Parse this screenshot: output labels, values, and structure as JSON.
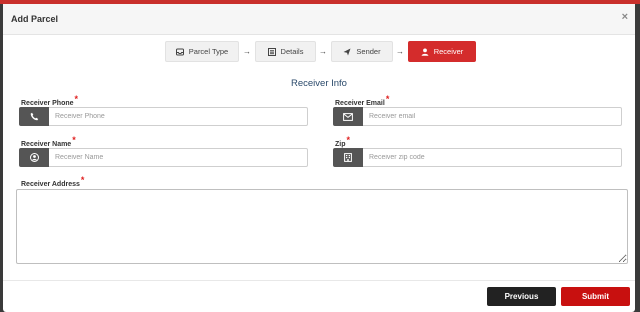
{
  "modal": {
    "title": "Add Parcel",
    "close_label": "×"
  },
  "steps": [
    {
      "label": "Parcel Type",
      "icon": "inbox-icon",
      "active": false
    },
    {
      "label": "Details",
      "icon": "list-icon",
      "active": false
    },
    {
      "label": "Sender",
      "icon": "send-icon",
      "active": false
    },
    {
      "label": "Receiver",
      "icon": "user-icon",
      "active": true
    }
  ],
  "step_arrow": "→",
  "section_title": "Receiver Info",
  "fields": {
    "phone": {
      "label": "Receiver Phone",
      "placeholder": "Receiver Phone",
      "value": "",
      "icon": "phone-icon"
    },
    "email": {
      "label": "Receiver Email",
      "placeholder": "Receiver email",
      "value": "",
      "icon": "envelope-icon"
    },
    "name": {
      "label": "Receiver Name",
      "placeholder": "Receiver Name",
      "value": "",
      "icon": "user-circle-icon"
    },
    "zip": {
      "label": "Zip",
      "placeholder": "Receiver zip code",
      "value": "",
      "icon": "building-icon"
    },
    "address": {
      "label": "Receiver Address",
      "value": ""
    }
  },
  "required_mark": "*",
  "buttons": {
    "previous": "Previous",
    "submit": "Submit"
  },
  "colors": {
    "accent": "#d42c2c",
    "submit": "#c8100f",
    "previous": "#222222",
    "addon": "#555555",
    "section_title": "#2b4a6b"
  }
}
